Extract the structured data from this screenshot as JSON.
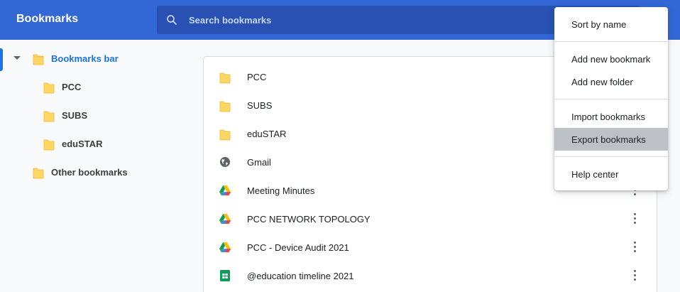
{
  "header": {
    "title": "Bookmarks",
    "search_placeholder": "Search bookmarks",
    "search_value": ""
  },
  "sidebar": {
    "items": [
      {
        "label": "Bookmarks bar",
        "icon": "folder-open-icon",
        "expanded": true,
        "selected": true
      },
      {
        "label": "PCC",
        "icon": "folder-icon"
      },
      {
        "label": "SUBS",
        "icon": "folder-icon"
      },
      {
        "label": "eduSTAR",
        "icon": "folder-icon"
      },
      {
        "label": "Other bookmarks",
        "icon": "folder-icon"
      }
    ]
  },
  "list": {
    "items": [
      {
        "label": "PCC",
        "icon": "folder-icon"
      },
      {
        "label": "SUBS",
        "icon": "folder-icon"
      },
      {
        "label": "eduSTAR",
        "icon": "folder-icon"
      },
      {
        "label": "Gmail",
        "icon": "globe-icon"
      },
      {
        "label": "Meeting Minutes",
        "icon": "google-drive-icon"
      },
      {
        "label": "PCC NETWORK TOPOLOGY",
        "icon": "google-drive-icon"
      },
      {
        "label": "PCC - Device Audit 2021",
        "icon": "google-drive-icon"
      },
      {
        "label": "@education timeline 2021",
        "icon": "google-sheets-icon"
      }
    ]
  },
  "menu": {
    "items": [
      {
        "label": "Sort by name"
      },
      {
        "label": "Add new bookmark"
      },
      {
        "label": "Add new folder"
      },
      {
        "label": "Import bookmarks"
      },
      {
        "label": "Export bookmarks",
        "highlighted": true
      },
      {
        "label": "Help center"
      }
    ]
  },
  "colors": {
    "header_bg": "#3367d6",
    "search_bg": "#2851b3",
    "accent": "#1a73e8",
    "folder_fill": "#fdd663",
    "menu_hover": "#bdc1c6"
  }
}
